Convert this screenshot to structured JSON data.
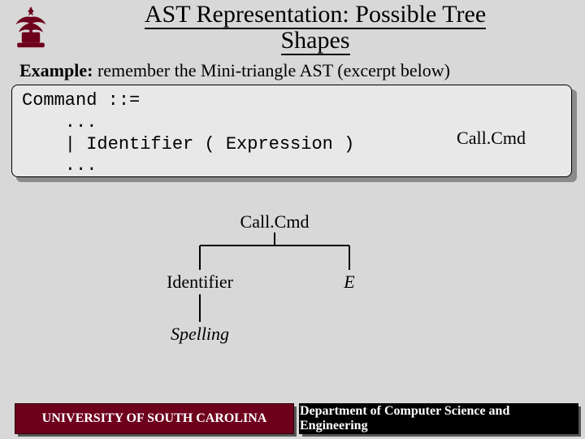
{
  "title_line1": "AST Representation: Possible Tree",
  "title_line2": "Shapes",
  "subtitle_bold": "Example:",
  "subtitle_rest": " remember the Mini-triangle AST (excerpt below)",
  "code": {
    "l1": "Command ::=",
    "l2": "    ...",
    "l3": "    | Identifier ( Expression )",
    "l4": "    ...",
    "right_label": "Call.Cmd"
  },
  "tree": {
    "root": "Call.Cmd",
    "left_child": "Identifier",
    "right_child": "E",
    "left_leaf": "Spelling"
  },
  "footer": {
    "left": "UNIVERSITY OF SOUTH CAROLINA",
    "right": "Department of Computer Science and Engineering"
  }
}
